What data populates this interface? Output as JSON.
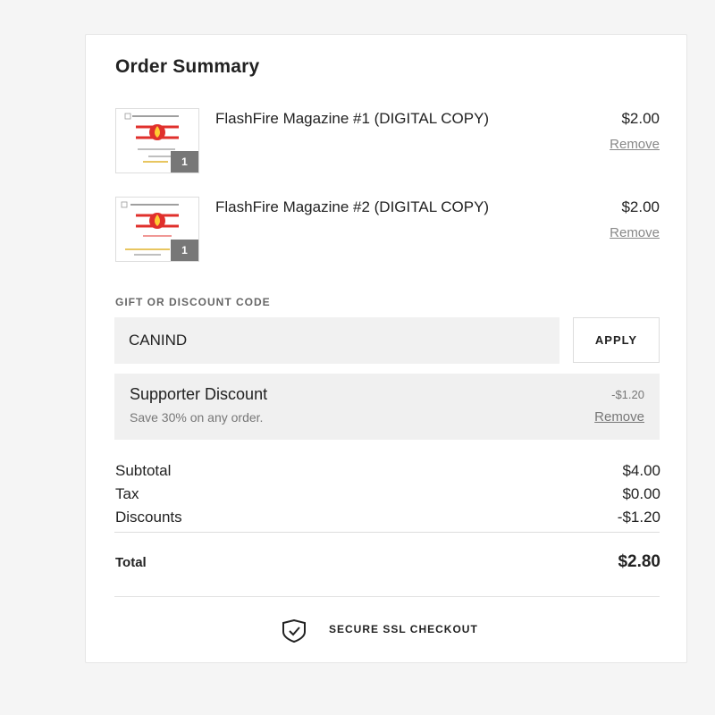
{
  "order_summary": {
    "title": "Order Summary",
    "items": [
      {
        "name": "FlashFire Magazine #1 (DIGITAL COPY)",
        "price": "$2.00",
        "remove_label": "Remove",
        "quantity": "1"
      },
      {
        "name": "FlashFire Magazine #2 (DIGITAL COPY)",
        "price": "$2.00",
        "remove_label": "Remove",
        "quantity": "1"
      }
    ],
    "discount_code": {
      "label": "GIFT OR DISCOUNT CODE",
      "value": "CANIND",
      "apply_label": "APPLY"
    },
    "applied_discount": {
      "name": "Supporter Discount",
      "description": "Save 30% on any order.",
      "amount": "-$1.20",
      "remove_label": "Remove"
    },
    "totals": {
      "subtotal_label": "Subtotal",
      "subtotal_value": "$4.00",
      "tax_label": "Tax",
      "tax_value": "$0.00",
      "discounts_label": "Discounts",
      "discounts_value": "-$1.20",
      "total_label": "Total",
      "total_value": "$2.80"
    },
    "secure_label": "SECURE SSL CHECKOUT"
  },
  "icons": {
    "secure": "shield-check-icon"
  },
  "colors": {
    "background": "#f5f5f5",
    "card": "#ffffff",
    "accent_red": "#e0302c",
    "qty_badge": "#777777"
  }
}
